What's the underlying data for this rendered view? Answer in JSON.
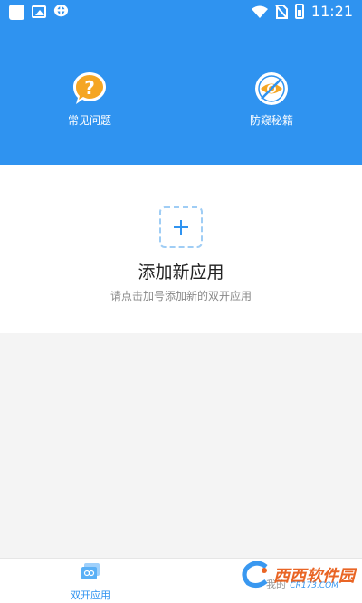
{
  "status_bar": {
    "time": "11:21"
  },
  "header": {
    "features": [
      {
        "label": "常见问题",
        "icon": "question-icon"
      },
      {
        "label": "防窥秘籍",
        "icon": "no-peek-icon"
      }
    ]
  },
  "add": {
    "title": "添加新应用",
    "subtitle": "请点击加号添加新的双开应用"
  },
  "bottom_nav": {
    "items": [
      {
        "label": "双开应用",
        "active": true
      },
      {
        "label": "我的",
        "active": false
      }
    ]
  },
  "watermark": {
    "text": "西西软件园",
    "sub": "CR173.COM"
  },
  "colors": {
    "primary": "#2f93f0",
    "accent_orange": "#f5a623",
    "background": "#f4f4f4"
  }
}
